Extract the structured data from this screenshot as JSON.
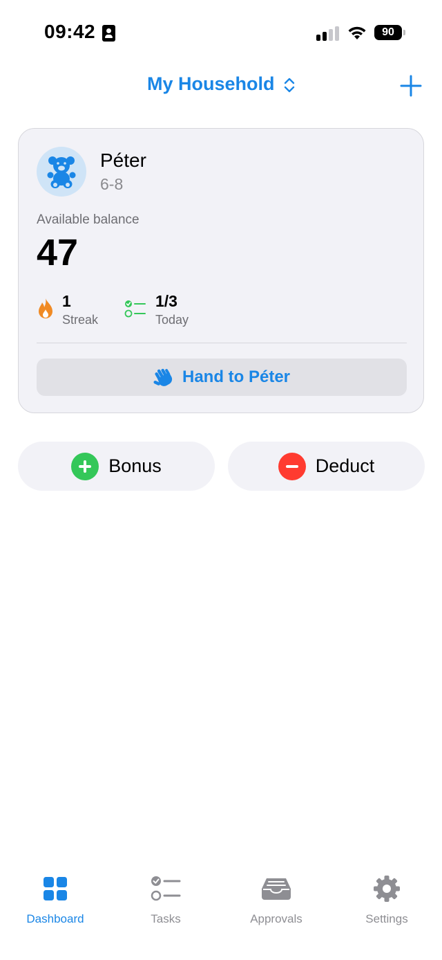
{
  "status_bar": {
    "time": "09:42",
    "battery": "90"
  },
  "header": {
    "title": "My Household"
  },
  "child": {
    "name": "Péter",
    "age_range": "6-8",
    "balance_label": "Available balance",
    "balance": "47",
    "streak": {
      "value": "1",
      "label": "Streak"
    },
    "today": {
      "value": "1/3",
      "label": "Today"
    },
    "hand_button": "Hand to Péter"
  },
  "actions": {
    "bonus": "Bonus",
    "deduct": "Deduct"
  },
  "tabs": [
    {
      "label": "Dashboard",
      "icon": "grid-icon",
      "active": true
    },
    {
      "label": "Tasks",
      "icon": "checklist-icon",
      "active": false
    },
    {
      "label": "Approvals",
      "icon": "tray-icon",
      "active": false
    },
    {
      "label": "Settings",
      "icon": "gear-icon",
      "active": false
    }
  ],
  "colors": {
    "accent": "#1a86e6",
    "bonus": "#34c759",
    "deduct": "#ff3b30",
    "streak": "#f08a24",
    "card": "#f2f2f7"
  }
}
